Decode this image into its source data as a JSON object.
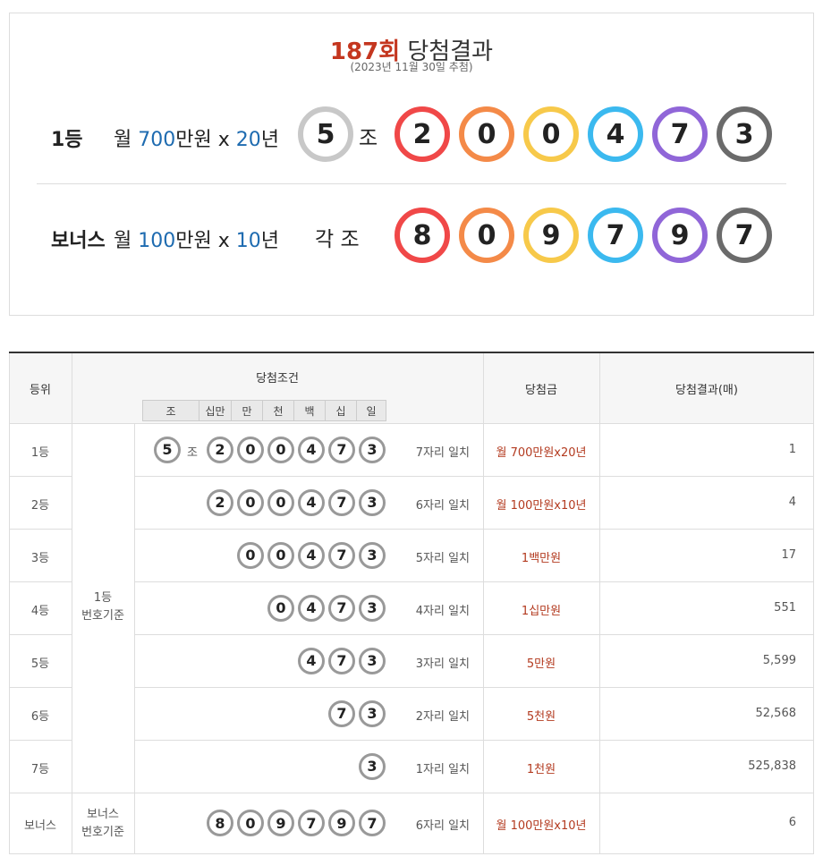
{
  "header": {
    "round": "187회",
    "label": "당첨결과",
    "draw_date": "(2023년 11월 30일 추첨)"
  },
  "first_prize": {
    "label": "1등",
    "amount_prefix": "월 ",
    "amount_value": "700",
    "amount_unit": "만원 x ",
    "years_value": "20",
    "years_unit": "년",
    "group_number": "5",
    "group_label": "조",
    "numbers": [
      "2",
      "0",
      "0",
      "4",
      "7",
      "3"
    ]
  },
  "bonus_prize": {
    "label": "보너스",
    "amount_prefix": " 월 ",
    "amount_value": "100",
    "amount_unit": "만원 x ",
    "years_value": "10",
    "years_unit": "년",
    "group_label": "각 조",
    "numbers": [
      "8",
      "0",
      "9",
      "7",
      "9",
      "7"
    ]
  },
  "table": {
    "headers": {
      "rank": "등위",
      "condition": "당첨조건",
      "prize": "당첨금",
      "result": "당첨결과(매)"
    },
    "digit_headers": [
      "조",
      "십만",
      "만",
      "천",
      "백",
      "십",
      "일"
    ],
    "basis_first": "1등\n번호기준",
    "basis_first_line1": "1등",
    "basis_first_line2": "번호기준",
    "basis_bonus_line1": "보너스",
    "basis_bonus_line2": "번호기준",
    "jo_label": "조",
    "rows": [
      {
        "rank": "1등",
        "group": "5",
        "numbers": [
          "2",
          "0",
          "0",
          "4",
          "7",
          "3"
        ],
        "match": "7자리 일치",
        "prize": "월 700만원x20년",
        "count": "1"
      },
      {
        "rank": "2등",
        "numbers": [
          "2",
          "0",
          "0",
          "4",
          "7",
          "3"
        ],
        "match": "6자리 일치",
        "prize": "월 100만원x10년",
        "count": "4"
      },
      {
        "rank": "3등",
        "numbers": [
          "0",
          "0",
          "4",
          "7",
          "3"
        ],
        "match": "5자리 일치",
        "prize": "1백만원",
        "count": "17"
      },
      {
        "rank": "4등",
        "numbers": [
          "0",
          "4",
          "7",
          "3"
        ],
        "match": "4자리 일치",
        "prize": "1십만원",
        "count": "551"
      },
      {
        "rank": "5등",
        "numbers": [
          "4",
          "7",
          "3"
        ],
        "match": "3자리 일치",
        "prize": "5만원",
        "count": "5,599"
      },
      {
        "rank": "6등",
        "numbers": [
          "7",
          "3"
        ],
        "match": "2자리 일치",
        "prize": "5천원",
        "count": "52,568"
      },
      {
        "rank": "7등",
        "numbers": [
          "3"
        ],
        "match": "1자리 일치",
        "prize": "1천원",
        "count": "525,838"
      },
      {
        "rank": "보너스",
        "numbers": [
          "8",
          "0",
          "9",
          "7",
          "9",
          "7"
        ],
        "match": "6자리 일치",
        "prize": "월 100만원x10년",
        "count": "6"
      }
    ]
  },
  "colors": {
    "position_1": "#f04848",
    "position_2": "#f48a48",
    "position_3": "#f7c94a",
    "position_4": "#3bb9ef",
    "position_5": "#9066d8",
    "position_6": "#6b6b6b",
    "group": "#c8c8c8",
    "accent_red": "#c4361f",
    "accent_blue": "#1e6bb0"
  }
}
